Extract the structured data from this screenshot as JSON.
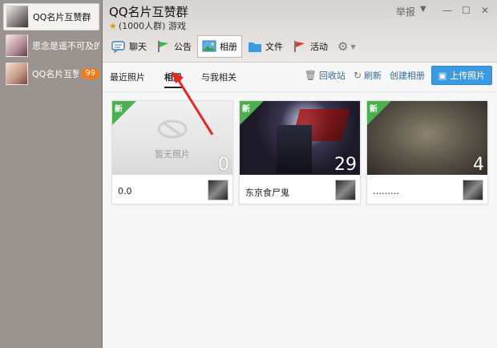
{
  "sidebar": {
    "items": [
      {
        "label": "QQ名片互赞群",
        "badge": ""
      },
      {
        "label": "思念是遥不可及的",
        "badge": ""
      },
      {
        "label": "QQ名片互赞",
        "badge": "99"
      }
    ]
  },
  "window": {
    "title": "QQ名片互赞群",
    "subtitle": "(1000人群) 游戏",
    "report_label": "举报"
  },
  "toolbar": {
    "items": [
      {
        "label": "聊天",
        "icon": "chat-icon"
      },
      {
        "label": "公告",
        "icon": "flag-icon"
      },
      {
        "label": "相册",
        "icon": "photo-icon"
      },
      {
        "label": "文件",
        "icon": "folder-icon"
      },
      {
        "label": "活动",
        "icon": "flag-red-icon"
      }
    ]
  },
  "tabs": [
    {
      "label": "最近照片"
    },
    {
      "label": "相册"
    },
    {
      "label": "与我相关"
    }
  ],
  "actions": {
    "recycle": "回收站",
    "refresh": "刷新",
    "create": "创建相册",
    "upload": "上传照片"
  },
  "albums": [
    {
      "name": "0.0",
      "count": "0",
      "empty_text": "暂无照片",
      "new": "新"
    },
    {
      "name": "东京食尸鬼",
      "count": "29",
      "new": "新"
    },
    {
      "name": "………",
      "count": "4",
      "new": "新"
    }
  ],
  "colors": {
    "accent": "#3c9ae0",
    "badge": "#f07a1e",
    "new_ribbon": "#4caf50",
    "annotation": "#e8281e"
  }
}
